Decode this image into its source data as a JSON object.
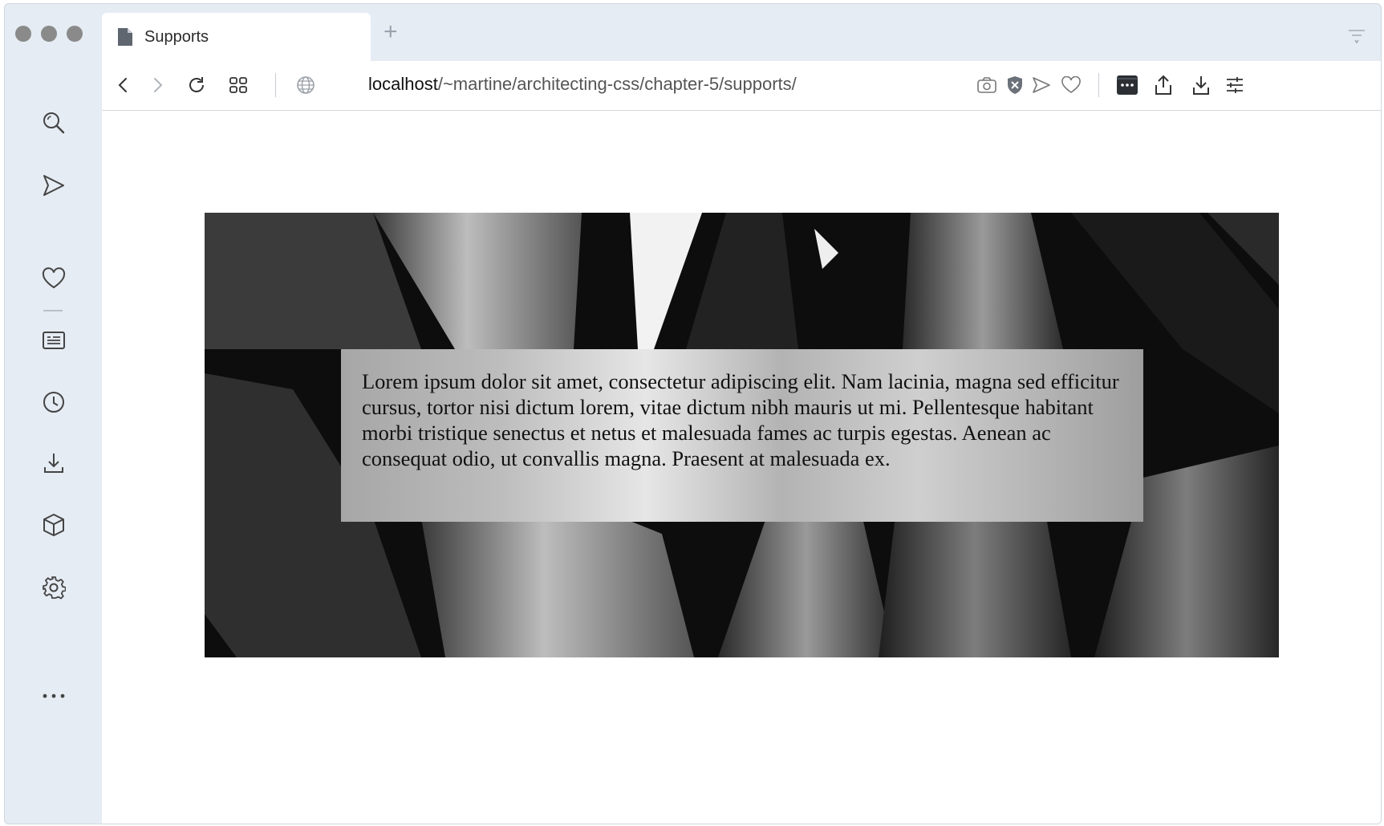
{
  "window": {
    "traffic_light_color": "#8a8a8a",
    "chrome_color": "#e6ecf4"
  },
  "tab": {
    "title": "Supports",
    "new_tab_label": "+"
  },
  "toolbar": {
    "url_host": "localhost",
    "url_path": "/~martine/architecting-css/chapter-5/supports/",
    "icons": [
      "back-icon",
      "forward-icon",
      "reload-icon",
      "tiles-icon",
      "globe-icon",
      "camera-icon",
      "shield-icon",
      "send-icon",
      "heart-icon",
      "wallet-icon",
      "share-icon",
      "download-icon",
      "settings-sliders-icon"
    ]
  },
  "sidebar": {
    "items": [
      "search-icon",
      "send-icon",
      "heart-icon",
      "news-icon",
      "history-icon",
      "download-icon",
      "cube-icon",
      "gear-icon",
      "more-icon"
    ]
  },
  "page": {
    "paragraph": "Lorem ipsum dolor sit amet, consectetur adipiscing elit. Nam lacinia, magna sed efficitur cursus, tortor nisi dictum lorem, vitae dictum nibh mauris ut mi. Pellentesque habitant morbi tristique senectus et netus et malesuada fames ac turpis egestas. Aenean ac consequat odio, ut convallis magna. Praesent at malesuada ex."
  }
}
